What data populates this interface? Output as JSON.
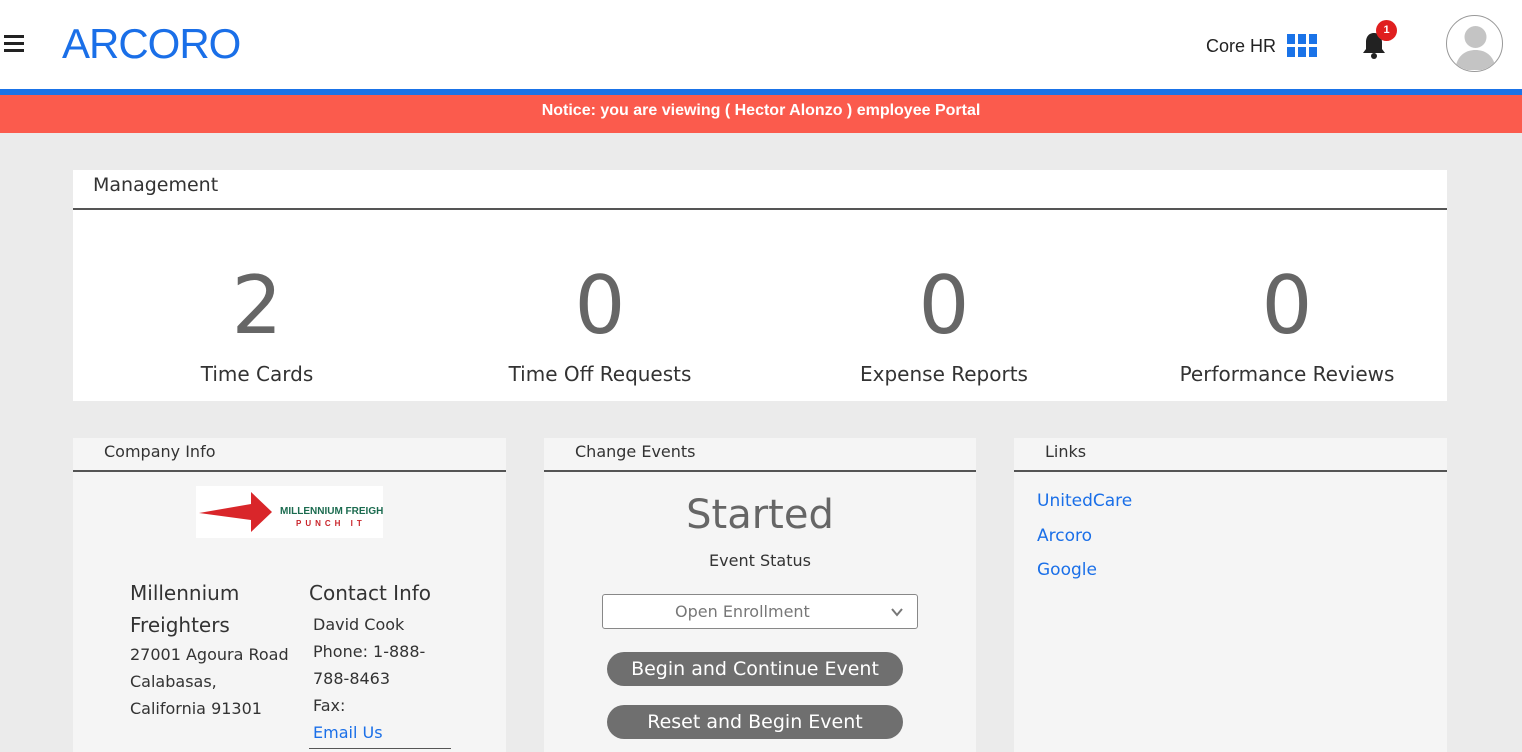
{
  "header": {
    "logo_text": "ARCORO",
    "module_label": "Core HR",
    "notification_count": "1",
    "brand_color": "#1a6fe8"
  },
  "notice": {
    "text": "Notice: you are viewing ( Hector Alonzo ) employee Portal",
    "color": "#fb5b4d"
  },
  "management": {
    "title": "Management",
    "stats": [
      {
        "value": "2",
        "label": "Time Cards"
      },
      {
        "value": "0",
        "label": "Time Off Requests"
      },
      {
        "value": "0",
        "label": "Expense Reports"
      },
      {
        "value": "0",
        "label": "Performance Reviews"
      }
    ]
  },
  "company_info": {
    "title": "Company Info",
    "logo_text": "MILLENNIUM FREIGHTERS",
    "logo_tagline": "PUNCH IT",
    "name": "Millennium Freighters",
    "address_line1": "27001 Agoura Road",
    "address_line2": "Calabasas, California 91301",
    "contact": {
      "title": "Contact Info",
      "name": "David Cook",
      "phone": "Phone: 1-888-788-8463",
      "fax": "Fax:",
      "email_link": "Email Us"
    }
  },
  "change_events": {
    "title": "Change Events",
    "status": "Started",
    "status_label": "Event Status",
    "selected_event": "Open Enrollment",
    "begin_button": "Begin and Continue Event",
    "reset_button": "Reset and Begin Event"
  },
  "links": {
    "title": "Links",
    "items": [
      "UnitedCare",
      "Arcoro",
      "Google"
    ]
  }
}
